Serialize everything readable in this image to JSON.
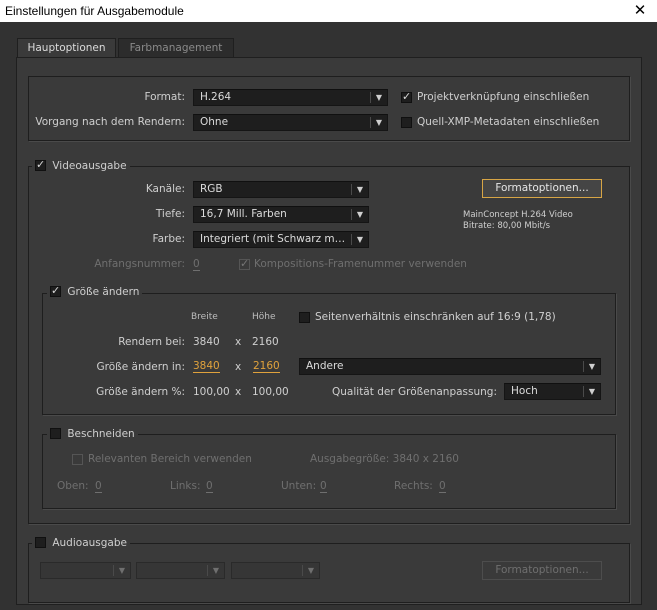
{
  "window": {
    "title": "Einstellungen für Ausgabemodule",
    "close_glyph": "✕"
  },
  "tabs": [
    {
      "label": "Hauptoptionen",
      "active": true
    },
    {
      "label": "Farbmanagement",
      "active": false
    }
  ],
  "top": {
    "format_label": "Format:",
    "format_value": "H.264",
    "post_render_label": "Vorgang nach dem Rendern:",
    "post_render_value": "Ohne",
    "include_project_link_label": "Projektverknüpfung einschließen",
    "include_project_link_checked": true,
    "include_xmp_label": "Quell-XMP-Metadaten einschließen",
    "include_xmp_checked": false
  },
  "video": {
    "section_label": "Videoausgabe",
    "enabled": true,
    "channels_label": "Kanäle:",
    "channels_value": "RGB",
    "depth_label": "Tiefe:",
    "depth_value": "16,7 Mill. Farben",
    "color_label": "Farbe:",
    "color_value": "Integriert (mit Schwarz mas...",
    "format_options_button": "Formatoptionen...",
    "codec_info_line1": "MainConcept H.264 Video",
    "codec_info_line2": "Bitrate: 80,00 Mbit/s",
    "start_number_label": "Anfangsnummer:",
    "start_number_value": "0",
    "use_comp_frame_label": "Kompositions-Framenummer verwenden",
    "use_comp_frame_checked": true
  },
  "resize": {
    "section_label": "Größe ändern",
    "enabled": true,
    "col_width": "Breite",
    "col_height": "Höhe",
    "lock_aspect_label": "Seitenverhältnis einschränken auf 16:9 (1,78)",
    "lock_aspect_checked": false,
    "render_at_label": "Rendern bei:",
    "render_at_w": "3840",
    "render_at_h": "2160",
    "times": "x",
    "resize_to_label": "Größe ändern in:",
    "resize_to_w": "3840",
    "resize_to_h": "2160",
    "preset_value": "Andere",
    "resize_pct_label": "Größe ändern %:",
    "resize_pct_w": "100,00",
    "resize_pct_h": "100,00",
    "quality_label": "Qualität der Größenanpassung:",
    "quality_value": "Hoch"
  },
  "crop": {
    "section_label": "Beschneiden",
    "enabled": false,
    "use_roi_label": "Relevanten Bereich verwenden",
    "output_size_label": "Ausgabegröße: 3840 x 2160",
    "top_label": "Oben:",
    "top_value": "0",
    "left_label": "Links:",
    "left_value": "0",
    "bottom_label": "Unten:",
    "bottom_value": "0",
    "right_label": "Rechts:",
    "right_value": "0"
  },
  "audio": {
    "section_label": "Audioausgabe",
    "enabled": false,
    "format_options_button": "Formatoptionen..."
  },
  "glyphs": {
    "arrow": "▼",
    "check": "✓"
  }
}
